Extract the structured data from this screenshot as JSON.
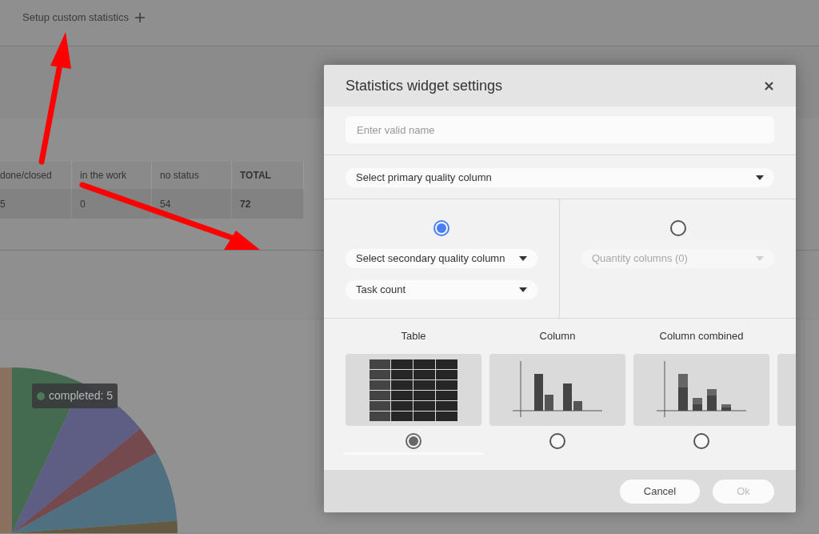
{
  "page": {
    "title": "Setup custom statistics"
  },
  "summary_table": {
    "columns": [
      "done/closed",
      "in the work",
      "no status",
      "TOTAL"
    ],
    "rows": [
      [
        "5",
        "0",
        "54",
        "72"
      ]
    ]
  },
  "chart_tooltip": {
    "label": "completed: 5"
  },
  "dialog": {
    "title": "Statistics widget settings",
    "name_field": {
      "placeholder": "Enter valid name"
    },
    "primary_select": {
      "value": "Select primary quality column"
    },
    "modes": [
      {
        "selected": true,
        "selects": [
          {
            "value": "Select secondary quality column",
            "disabled": false
          },
          {
            "value": "Task count",
            "disabled": false
          }
        ]
      },
      {
        "selected": false,
        "selects": [
          {
            "value": "Quantity columns (0)",
            "disabled": true
          }
        ]
      }
    ],
    "widget_types": [
      {
        "label": "Table",
        "kind": "table",
        "selected": true
      },
      {
        "label": "Column",
        "kind": "column",
        "selected": false
      },
      {
        "label": "Column combined",
        "kind": "stacked",
        "selected": false
      },
      {
        "kind": "partial"
      }
    ],
    "buttons": [
      {
        "label": "Cancel",
        "disabled": false
      },
      {
        "label": "Ok",
        "disabled": true
      }
    ]
  }
}
